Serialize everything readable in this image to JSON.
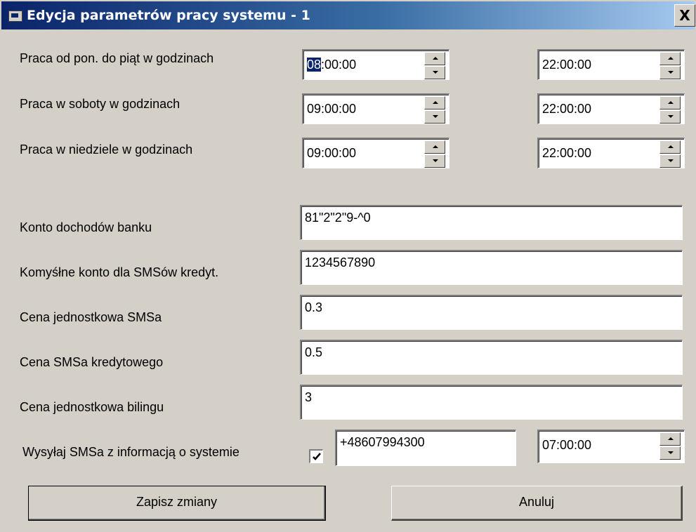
{
  "window": {
    "title": "Edycja parametrów pracy systemu - 1",
    "close_glyph": "X"
  },
  "schedule": [
    {
      "label": "Praca od pon. do piąt  w godzinach",
      "from_selected": "08",
      "from_rest": ":00:00",
      "to": "22:00:00"
    },
    {
      "label": "Praca w soboty w godzinach",
      "from": "09:00:00",
      "to": "22:00:00"
    },
    {
      "label": "Praca w niedziele w godzinach",
      "from": "09:00:00",
      "to": "22:00:00"
    }
  ],
  "fields": [
    {
      "label": "Konto dochodów banku",
      "value": "81\"2\"2\"9-^0"
    },
    {
      "label": "Komyśłne konto dla SMSów kredyt.",
      "value": "1234567890"
    },
    {
      "label": "Cena jednostkowa SMSa",
      "value": "0.3"
    },
    {
      "label": "Cena SMSa kredytowego",
      "value": "0.5"
    },
    {
      "label": "Cena jednostkowa bilingu",
      "value": "3"
    }
  ],
  "sms_info": {
    "label": "Wysyłaj SMSa z informacją o systemie",
    "checked": true,
    "phone": "+48607994300",
    "time": "07:00:00"
  },
  "buttons": {
    "save": "Zapisz zmiany",
    "cancel": "Anuluj"
  },
  "colors": {
    "face": "#d4d0c8",
    "title_start": "#0a246a",
    "title_end": "#a6caf0",
    "selection": "#0a246a"
  }
}
